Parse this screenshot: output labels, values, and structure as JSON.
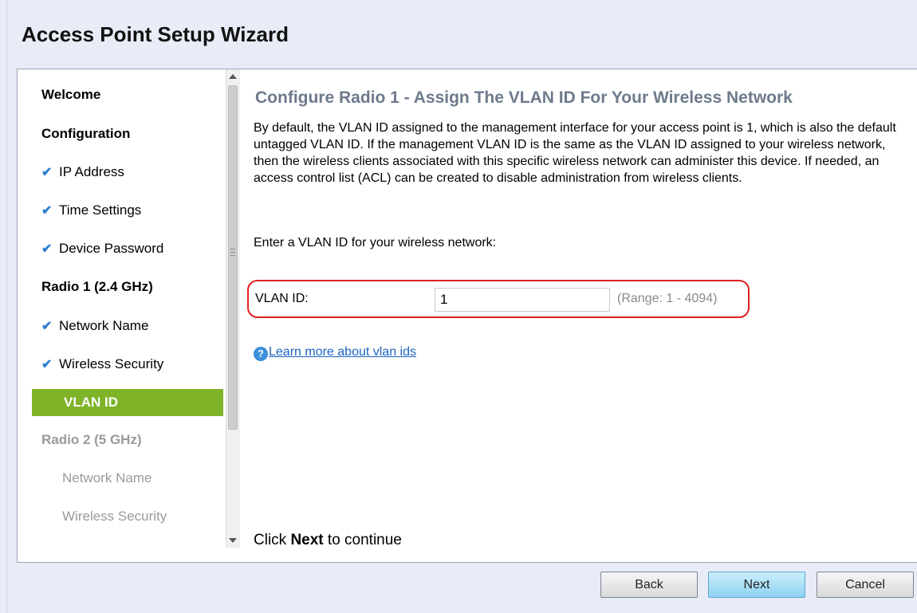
{
  "wizard": {
    "title": "Access Point Setup Wizard"
  },
  "sidebar": {
    "items": [
      {
        "label": "Welcome",
        "kind": "section",
        "state": "done"
      },
      {
        "label": "Configuration",
        "kind": "section",
        "state": "done"
      },
      {
        "label": "IP Address",
        "kind": "step",
        "state": "done",
        "icon": "check-icon"
      },
      {
        "label": "Time Settings",
        "kind": "step",
        "state": "done",
        "icon": "check-icon"
      },
      {
        "label": "Device Password",
        "kind": "step",
        "state": "done",
        "icon": "check-icon"
      },
      {
        "label": "Radio 1 (2.4 GHz)",
        "kind": "section",
        "state": "done"
      },
      {
        "label": "Network Name",
        "kind": "step",
        "state": "done",
        "icon": "check-icon"
      },
      {
        "label": "Wireless Security",
        "kind": "step",
        "state": "done",
        "icon": "check-icon"
      },
      {
        "label": "VLAN ID",
        "kind": "step",
        "state": "active"
      },
      {
        "label": "Radio 2 (5 GHz)",
        "kind": "section",
        "state": "disabled"
      },
      {
        "label": "Network Name",
        "kind": "step",
        "state": "disabled"
      },
      {
        "label": "Wireless Security",
        "kind": "step",
        "state": "disabled"
      }
    ],
    "check_glyph": "✔"
  },
  "content": {
    "title": "Configure Radio 1 - Assign The VLAN ID For Your Wireless Network",
    "description": "By default, the VLAN ID assigned to the management interface for your access point is 1, which is also the default untagged VLAN ID. If the management VLAN ID is the same as the VLAN ID assigned to your wireless network, then the wireless clients associated with this specific wireless network can administer this device. If needed, an access control list (ACL) can be created to disable administration from wireless clients.",
    "prompt": "Enter a VLAN ID for your wireless network:",
    "vlan": {
      "label": "VLAN ID:",
      "value": "1",
      "range": "(Range: 1 - 4094)"
    },
    "learn_more": {
      "icon_glyph": "?",
      "text": "Learn more about vlan ids"
    },
    "continue": {
      "prefix": "Click ",
      "bold": "Next",
      "suffix": " to continue"
    }
  },
  "footer": {
    "back_label": "Back",
    "next_label": "Next",
    "cancel_label": "Cancel"
  },
  "colors": {
    "active_nav": "#7fb429",
    "highlight_border": "#e02020",
    "check": "#2f7fd0",
    "next_button": "#8fd3f2"
  }
}
